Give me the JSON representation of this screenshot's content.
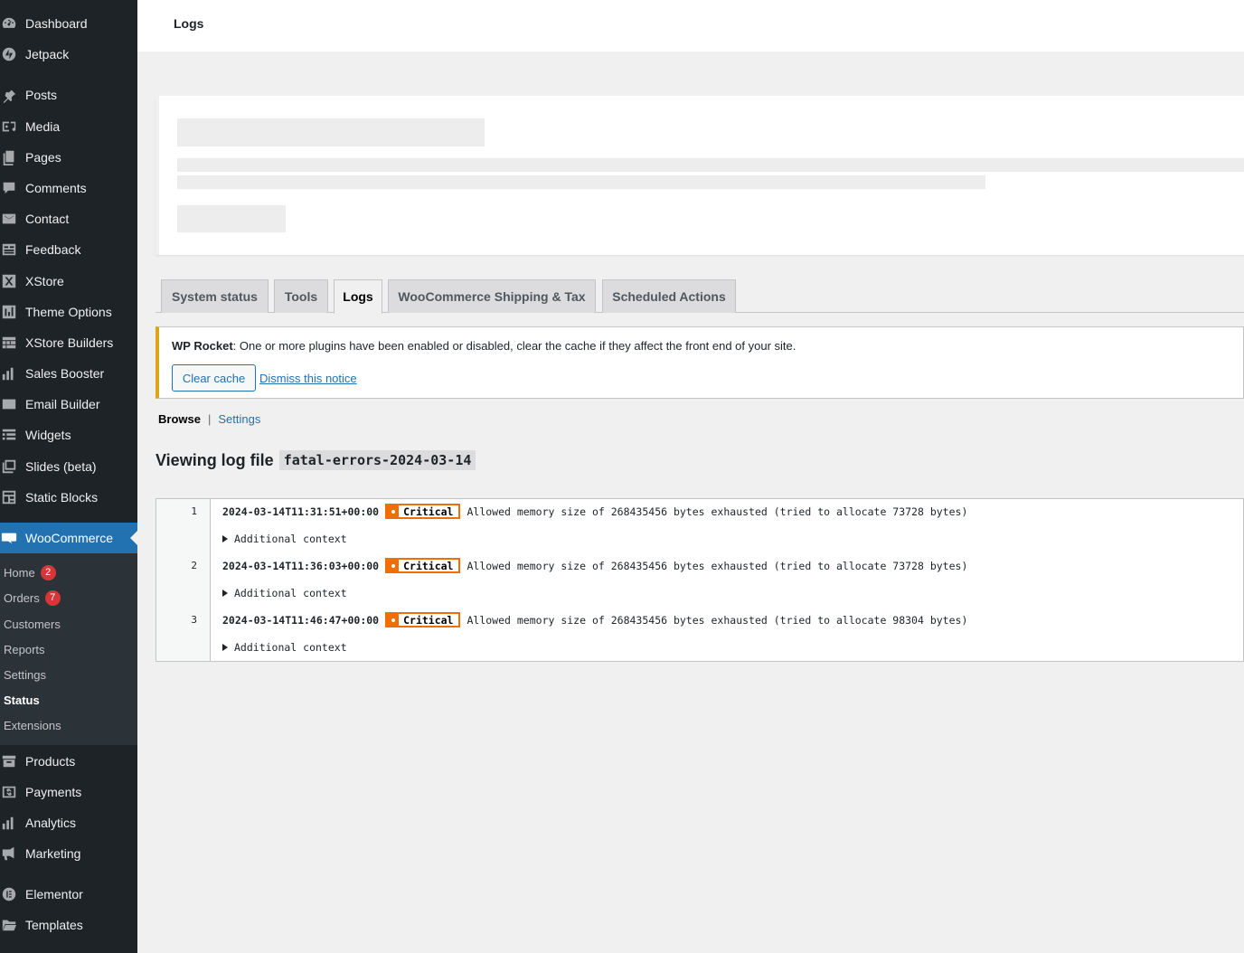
{
  "sidebar": {
    "items": [
      {
        "label": "Dashboard",
        "icon": "dashboard-icon"
      },
      {
        "label": "Jetpack",
        "icon": "jetpack-icon"
      },
      {
        "label": "Posts",
        "icon": "pin-icon"
      },
      {
        "label": "Media",
        "icon": "media-icon"
      },
      {
        "label": "Pages",
        "icon": "pages-icon"
      },
      {
        "label": "Comments",
        "icon": "comment-icon"
      },
      {
        "label": "Contact",
        "icon": "envelope-icon"
      },
      {
        "label": "Feedback",
        "icon": "feedback-icon"
      },
      {
        "label": "XStore",
        "icon": "xstore-icon"
      },
      {
        "label": "Theme Options",
        "icon": "theme-options-icon"
      },
      {
        "label": "XStore Builders",
        "icon": "builders-icon"
      },
      {
        "label": "Sales Booster",
        "icon": "bar-chart-icon"
      },
      {
        "label": "Email Builder",
        "icon": "email-icon"
      },
      {
        "label": "Widgets",
        "icon": "widgets-icon"
      },
      {
        "label": "Slides (beta)",
        "icon": "slides-icon"
      },
      {
        "label": "Static Blocks",
        "icon": "blocks-icon"
      },
      {
        "label": "WooCommerce",
        "icon": "woo-icon"
      },
      {
        "label": "Products",
        "icon": "archive-icon"
      },
      {
        "label": "Payments",
        "icon": "dollar-icon"
      },
      {
        "label": "Analytics",
        "icon": "bar-chart-icon"
      },
      {
        "label": "Marketing",
        "icon": "megaphone-icon"
      },
      {
        "label": "Elementor",
        "icon": "elementor-icon"
      },
      {
        "label": "Templates",
        "icon": "folder-icon"
      }
    ],
    "submenu": [
      {
        "label": "Home",
        "badge": "2"
      },
      {
        "label": "Orders",
        "badge": "7"
      },
      {
        "label": "Customers"
      },
      {
        "label": "Reports"
      },
      {
        "label": "Settings"
      },
      {
        "label": "Status"
      },
      {
        "label": "Extensions"
      }
    ]
  },
  "header": {
    "title": "Logs"
  },
  "tabs": [
    "System status",
    "Tools",
    "Logs",
    "WooCommerce Shipping & Tax",
    "Scheduled Actions"
  ],
  "notice": {
    "plugin": "WP Rocket",
    "message": ": One or more plugins have been enabled or disabled, clear the cache if they affect the front end of your site.",
    "clear_button": "Clear cache",
    "dismiss_link": "Dismiss this notice"
  },
  "subnav": {
    "browse": "Browse",
    "separator": "|",
    "settings": "Settings"
  },
  "viewing": {
    "label": "Viewing log file",
    "filename": "fatal-errors-2024-03-14"
  },
  "log": {
    "context_label": "Additional context",
    "entries": [
      {
        "line": "1",
        "timestamp": "2024-03-14T11:31:51+00:00",
        "level": "Critical",
        "message": "Allowed memory size of 268435456 bytes exhausted (tried to allocate 73728 bytes)"
      },
      {
        "line": "2",
        "timestamp": "2024-03-14T11:36:03+00:00",
        "level": "Critical",
        "message": "Allowed memory size of 268435456 bytes exhausted (tried to allocate 73728 bytes)"
      },
      {
        "line": "3",
        "timestamp": "2024-03-14T11:46:47+00:00",
        "level": "Critical",
        "message": "Allowed memory size of 268435456 bytes exhausted (tried to allocate 98304 bytes)"
      }
    ]
  },
  "colors": {
    "accent": "#2271b1",
    "sidebar_bg": "#1d2327",
    "critical": "#f06f04",
    "notice_warning": "#dba617",
    "badge": "#d63638"
  }
}
